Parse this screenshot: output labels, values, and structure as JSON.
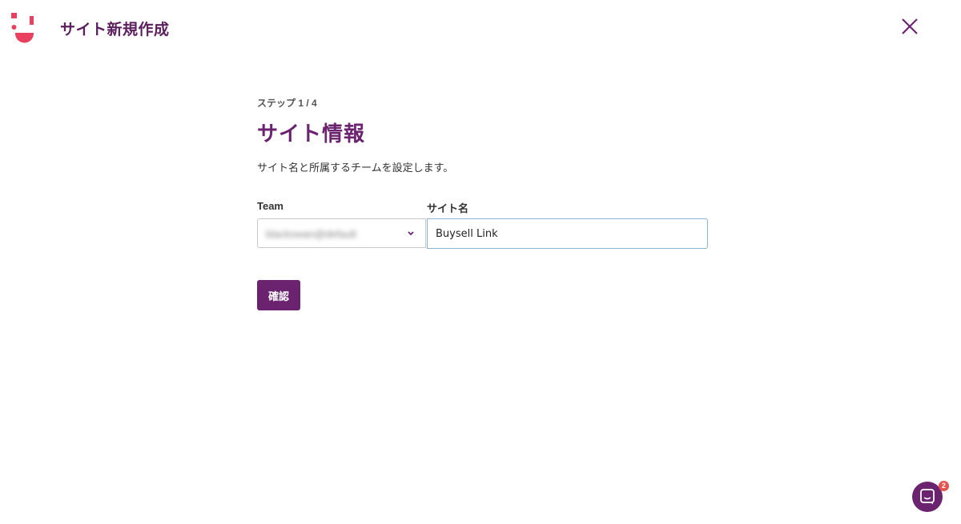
{
  "header": {
    "title": "サイト新規作成",
    "logo_icon": "brand-logo-icon",
    "close_icon": "close-icon",
    "brand_color": "#e8405e"
  },
  "main": {
    "step_label": "ステップ 1 / 4",
    "title": "サイト情報",
    "description": "サイト名と所属するチームを設定します。",
    "team": {
      "label": "Team",
      "value": "blackswan@default",
      "icon": "chevron-down-icon"
    },
    "site_name": {
      "label": "サイト名",
      "value": "Buysell Link"
    },
    "confirm_label": "確認",
    "accent_color": "#6b2370"
  },
  "chat": {
    "icon": "chat-bubble-icon",
    "badge_count": "2",
    "badge_color": "#e8524f"
  }
}
